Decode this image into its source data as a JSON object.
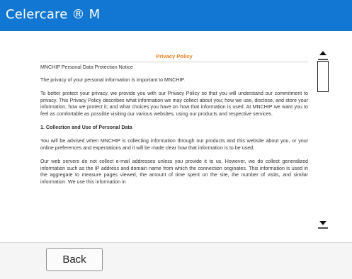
{
  "app": {
    "title": "Celercare ® M"
  },
  "document": {
    "heading": "Privacy Policy",
    "subtitle": "MNCHIP Personal Data Protection Notice",
    "paragraphs": [
      "The privacy of your personal information is important to MNCHIP.",
      "To better protect your privacy, we provide you with our Privacy Policy so that you will understand our commitment to privacy. This Privacy Policy describes what information we may collect about you; how we use, disclose, and store your information; how we protect it; and what choices you have on how that information is used. At MNCHIP we want you to feel as comfortable as possible visiting our various websites, using our products and respective services.",
      "1. Collection and Use of Personal Data",
      "You will be advised when MNCHIP is collecting information through our products and this website about you, or your online preferences and expectations and it will be made clear how that information is to be used.",
      "Our web servers do not collect e-mail addresses unless you provide it to us. However, we do collect generalized information such as the IP address and domain name from which the connection originates. This information is used in the aggregate to measure pages viewed, the amount of time spent on the site, the number of visits, and similar information. We use this information in"
    ]
  },
  "scrollbar": {
    "up_icon": "triangle-up",
    "down_icon": "triangle-down",
    "position": 0.0
  },
  "footer": {
    "back_label": "Back"
  }
}
